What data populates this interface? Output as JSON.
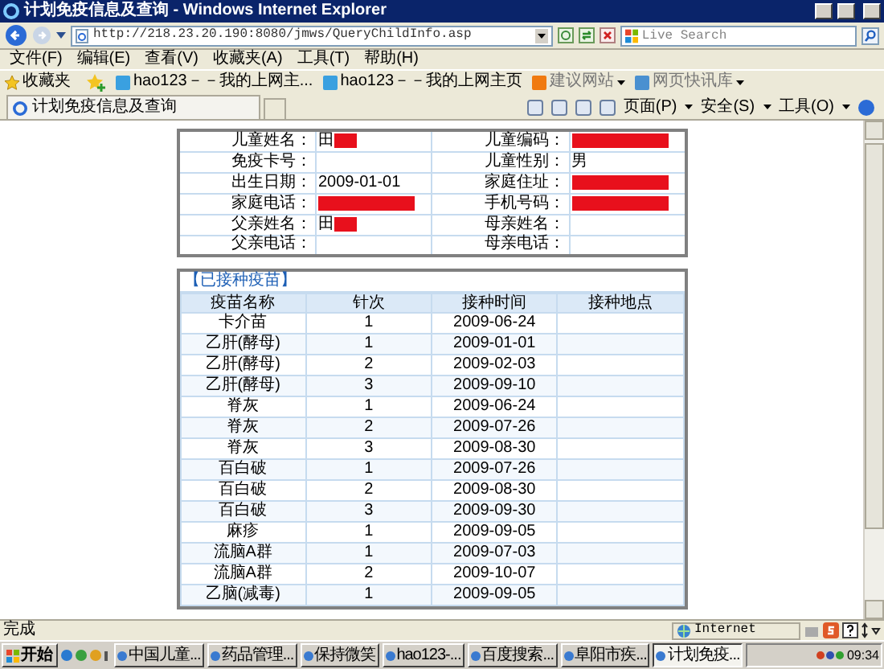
{
  "window": {
    "title": "计划免疫信息及查询 - Windows Internet Explorer"
  },
  "address_bar": {
    "url": "http://218.23.20.190:8080/jmws/QueryChildInfo.asp",
    "search_placeholder": "Live Search"
  },
  "menu": [
    "文件(F)",
    "编辑(E)",
    "查看(V)",
    "收藏夹(A)",
    "工具(T)",
    "帮助(H)"
  ],
  "favorites_bar": {
    "label": "收藏夹",
    "items": [
      {
        "label": "hao123－－我的上网主...",
        "dropdown": false
      },
      {
        "label": "hao123－－我的上网主页",
        "dropdown": false
      },
      {
        "label": "建议网站",
        "dropdown": true
      },
      {
        "label": "网页快讯库",
        "dropdown": true
      }
    ]
  },
  "tab": {
    "title": "计划免疫信息及查询"
  },
  "command_bar": [
    "页面(P)",
    "安全(S)",
    "工具(O)"
  ],
  "child_info": [
    [
      {
        "label": "儿童姓名：",
        "value": "田",
        "redacted": true
      },
      {
        "label": "儿童编码：",
        "redacted": true
      }
    ],
    [
      {
        "label": "免疫卡号：",
        "redacted": false
      },
      {
        "label": "儿童性别：",
        "value": "男",
        "redacted": false
      }
    ],
    [
      {
        "label": "出生日期：",
        "value": "2009-01-01",
        "redacted": false
      },
      {
        "label": "家庭住址：",
        "redacted": true
      }
    ],
    [
      {
        "label": "家庭电话：",
        "redacted": true
      },
      {
        "label": "手机号码：",
        "redacted": true
      }
    ],
    [
      {
        "label": "父亲姓名：",
        "value": "田",
        "redacted": true
      },
      {
        "label": "母亲姓名：",
        "redacted": false
      }
    ],
    [
      {
        "label": "父亲电话：",
        "redacted": false
      },
      {
        "label": "母亲电话：",
        "redacted": false
      }
    ]
  ],
  "vaccines": {
    "caption": "【已接种疫苗】",
    "columns": [
      "疫苗名称",
      "针次",
      "接种时间",
      "接种地点"
    ],
    "rows": [
      [
        "卡介苗",
        "1",
        "2009-06-24"
      ],
      [
        "乙肝(酵母)",
        "1",
        "2009-01-01"
      ],
      [
        "乙肝(酵母)",
        "2",
        "2009-02-03"
      ],
      [
        "乙肝(酵母)",
        "3",
        "2009-09-10"
      ],
      [
        "脊灰",
        "1",
        "2009-06-24"
      ],
      [
        "脊灰",
        "2",
        "2009-07-26"
      ],
      [
        "脊灰",
        "3",
        "2009-08-30"
      ],
      [
        "百白破",
        "1",
        "2009-07-26"
      ],
      [
        "百白破",
        "2",
        "2009-08-30"
      ],
      [
        "百白破",
        "3",
        "2009-09-30"
      ],
      [
        "麻疹",
        "1",
        "2009-09-05"
      ],
      [
        "流脑A群",
        "1",
        "2009-07-03"
      ],
      [
        "流脑A群",
        "2",
        "2009-10-07"
      ],
      [
        "乙脑(减毒)",
        "1",
        "2009-09-05"
      ]
    ]
  },
  "status_bar": {
    "text": "完成",
    "zone": "Internet"
  },
  "taskbar": {
    "start": "开始",
    "buttons": [
      {
        "label": "中国儿童...",
        "selected": false
      },
      {
        "label": "药品管理...",
        "selected": false
      },
      {
        "label": "保持微笑",
        "selected": false
      },
      {
        "label": "hao123-...",
        "selected": false
      },
      {
        "label": "百度搜索...",
        "selected": false
      },
      {
        "label": "阜阳市疾...",
        "selected": false
      },
      {
        "label": "计划免疫...",
        "selected": true
      }
    ],
    "clock": "09:34"
  }
}
